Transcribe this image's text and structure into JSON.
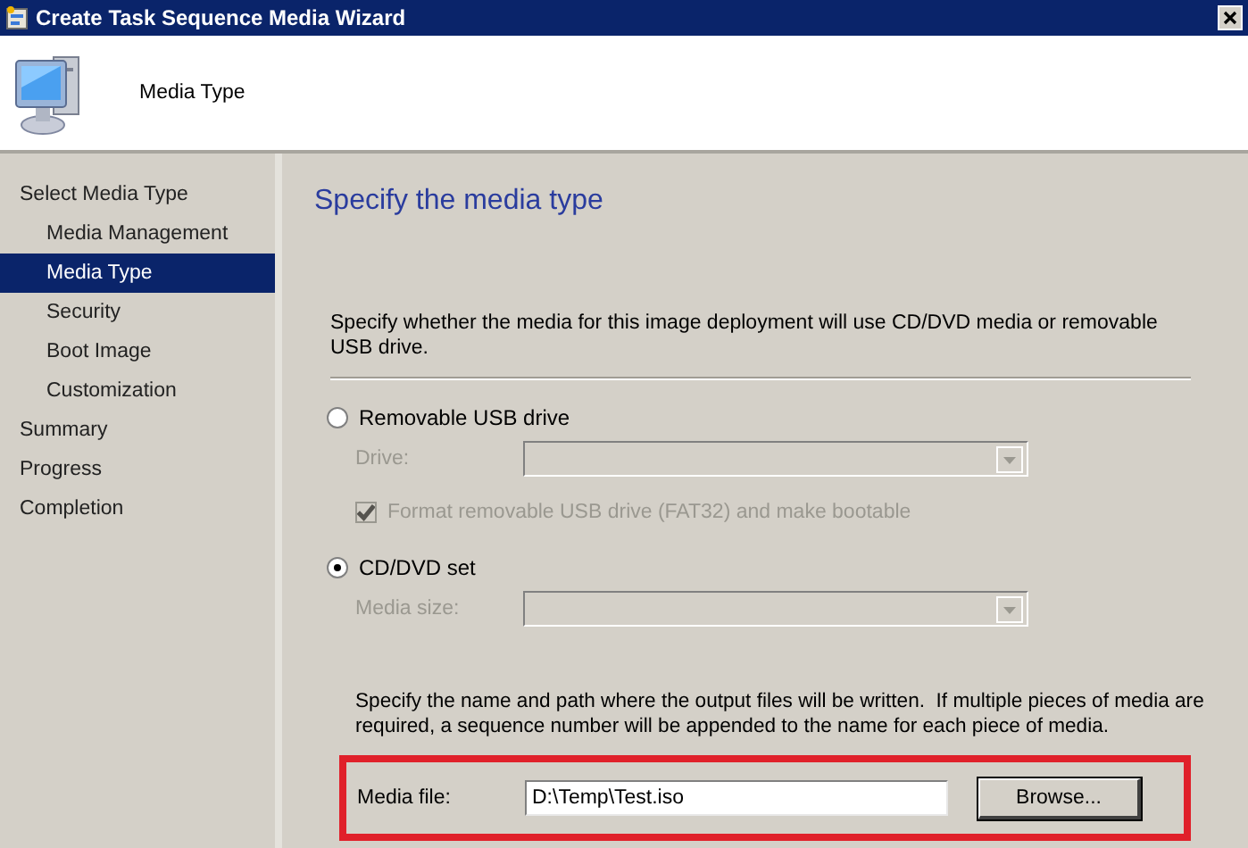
{
  "window": {
    "title": "Create Task Sequence Media Wizard"
  },
  "header": {
    "title": "Media Type"
  },
  "sidebar": {
    "items": [
      {
        "label": "Select Media Type",
        "selected": false,
        "children": [
          {
            "label": "Media Management",
            "selected": false
          },
          {
            "label": "Media Type",
            "selected": true
          },
          {
            "label": "Security",
            "selected": false
          },
          {
            "label": "Boot Image",
            "selected": false
          },
          {
            "label": "Customization",
            "selected": false
          }
        ]
      },
      {
        "label": "Summary",
        "selected": false
      },
      {
        "label": "Progress",
        "selected": false
      },
      {
        "label": "Completion",
        "selected": false
      }
    ]
  },
  "page": {
    "heading": "Specify the media type",
    "description": "Specify whether the media for this image deployment will use CD/DVD media or removable USB drive.",
    "options": [
      {
        "label": "Removable USB drive",
        "selected": false,
        "fields": [
          {
            "kind": "dropdown",
            "label": "Drive:",
            "disabled": true
          },
          {
            "kind": "checkbox",
            "label": "Format removable USB drive (FAT32) and make bootable",
            "checked": true,
            "disabled": true
          }
        ]
      },
      {
        "label": "CD/DVD set",
        "selected": true,
        "fields": [
          {
            "kind": "dropdown",
            "label": "Media size:",
            "disabled": true
          }
        ]
      }
    ],
    "output_note": "Specify the name and path where the output files will be written.  If multiple pieces of media are required, a sequence number will be appended to the name for each piece of media.",
    "media_file": {
      "label": "Media file:",
      "value": "D:\\Temp\\Test.iso",
      "button": "Browse...",
      "highlighted": true
    }
  }
}
